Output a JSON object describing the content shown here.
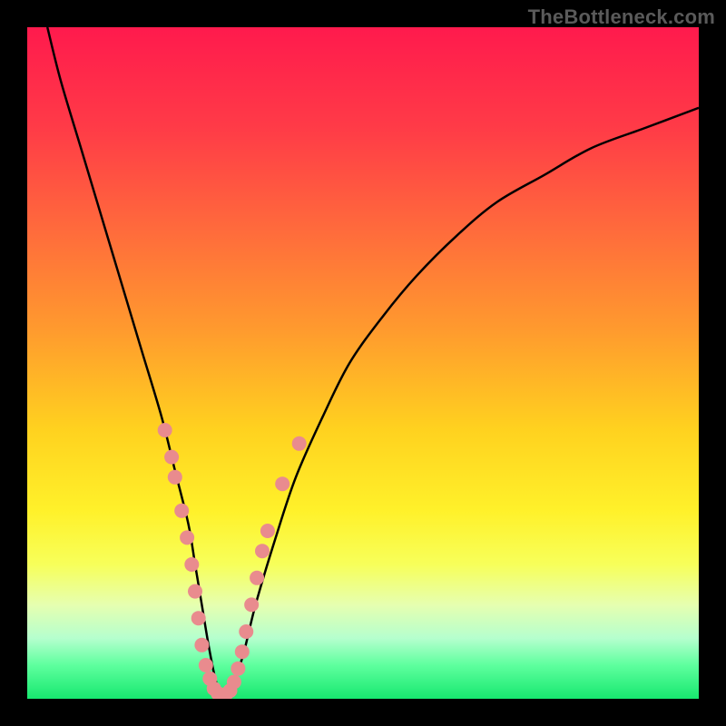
{
  "watermark": "TheBottleneck.com",
  "colors": {
    "gradient_stops": [
      {
        "offset": 0.0,
        "color": "#ff1a4d"
      },
      {
        "offset": 0.15,
        "color": "#ff3b47"
      },
      {
        "offset": 0.3,
        "color": "#ff6a3c"
      },
      {
        "offset": 0.45,
        "color": "#ff9a2e"
      },
      {
        "offset": 0.6,
        "color": "#ffd21f"
      },
      {
        "offset": 0.72,
        "color": "#fff12a"
      },
      {
        "offset": 0.8,
        "color": "#f7ff5a"
      },
      {
        "offset": 0.86,
        "color": "#e6ffb0"
      },
      {
        "offset": 0.91,
        "color": "#b5ffce"
      },
      {
        "offset": 0.95,
        "color": "#5eff9e"
      },
      {
        "offset": 1.0,
        "color": "#17e86f"
      }
    ],
    "curve": "#000000",
    "marker_fill": "#e98b8e",
    "marker_stroke": "#d97579"
  },
  "chart_data": {
    "type": "line",
    "title": "",
    "xlabel": "",
    "ylabel": "",
    "xlim": [
      0,
      100
    ],
    "ylim": [
      0,
      100
    ],
    "series": [
      {
        "name": "bottleneck-curve",
        "x": [
          3,
          5,
          8,
          11,
          14,
          17,
          20,
          22,
          24,
          25,
          26,
          27,
          28,
          29,
          30,
          32,
          34,
          37,
          40,
          44,
          48,
          53,
          58,
          64,
          70,
          77,
          84,
          92,
          100
        ],
        "values": [
          100,
          92,
          82,
          72,
          62,
          52,
          42,
          34,
          26,
          20,
          14,
          8,
          3,
          0,
          1,
          6,
          14,
          24,
          33,
          42,
          50,
          57,
          63,
          69,
          74,
          78,
          82,
          85,
          88
        ]
      }
    ],
    "markers": {
      "name": "sample-points",
      "points": [
        {
          "x": 20.5,
          "y": 40
        },
        {
          "x": 21.5,
          "y": 36
        },
        {
          "x": 22.0,
          "y": 33
        },
        {
          "x": 23.0,
          "y": 28
        },
        {
          "x": 23.8,
          "y": 24
        },
        {
          "x": 24.5,
          "y": 20
        },
        {
          "x": 25.0,
          "y": 16
        },
        {
          "x": 25.5,
          "y": 12
        },
        {
          "x": 26.0,
          "y": 8
        },
        {
          "x": 26.6,
          "y": 5
        },
        {
          "x": 27.2,
          "y": 3
        },
        {
          "x": 27.8,
          "y": 1.5
        },
        {
          "x": 28.4,
          "y": 0.8
        },
        {
          "x": 29.0,
          "y": 0.5
        },
        {
          "x": 29.6,
          "y": 0.7
        },
        {
          "x": 30.2,
          "y": 1.2
        },
        {
          "x": 30.8,
          "y": 2.5
        },
        {
          "x": 31.4,
          "y": 4.5
        },
        {
          "x": 32.0,
          "y": 7
        },
        {
          "x": 32.6,
          "y": 10
        },
        {
          "x": 33.4,
          "y": 14
        },
        {
          "x": 34.2,
          "y": 18
        },
        {
          "x": 35.0,
          "y": 22
        },
        {
          "x": 35.8,
          "y": 25
        },
        {
          "x": 38.0,
          "y": 32
        },
        {
          "x": 40.5,
          "y": 38
        }
      ]
    }
  }
}
